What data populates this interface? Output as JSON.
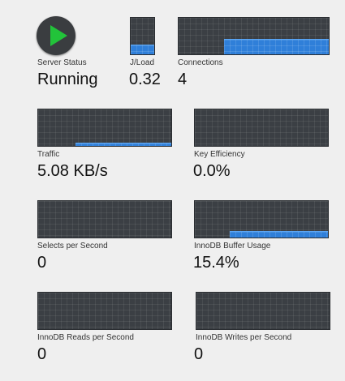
{
  "server_status": {
    "label": "Server Status",
    "value": "Running",
    "icon": "play-icon",
    "icon_color": "#22c33a"
  },
  "load": {
    "label": "J/Load",
    "value": "0.32",
    "fill_fraction": 0.25
  },
  "connections": {
    "label": "Connections",
    "value": "4",
    "fill_fraction": 0.4,
    "fill_start_fraction": 0.3
  },
  "traffic": {
    "label": "Traffic",
    "value": "5.08 KB/s",
    "fill_fraction": 0.07,
    "fill_start_fraction": 0.28
  },
  "key_efficiency": {
    "label": "Key Efficiency",
    "value": "0.0%",
    "fill_fraction": 0.0
  },
  "selects_per_second": {
    "label": "Selects per Second",
    "value": "0",
    "fill_fraction": 0.0
  },
  "innodb_buffer_usage": {
    "label": "InnoDB Buffer Usage",
    "value": "15.4%",
    "fill_fraction": 0.15,
    "fill_start_fraction": 0.26
  },
  "innodb_reads_per_second": {
    "label": "InnoDB Reads per Second",
    "value": "0",
    "fill_fraction": 0.0
  },
  "innodb_writes_per_second": {
    "label": "InnoDB Writes per Second",
    "value": "0",
    "fill_fraction": 0.0
  },
  "colors": {
    "graph_bg": "#3b3f44",
    "graph_fill": "#2f7fd9",
    "page_bg": "#efefef"
  }
}
